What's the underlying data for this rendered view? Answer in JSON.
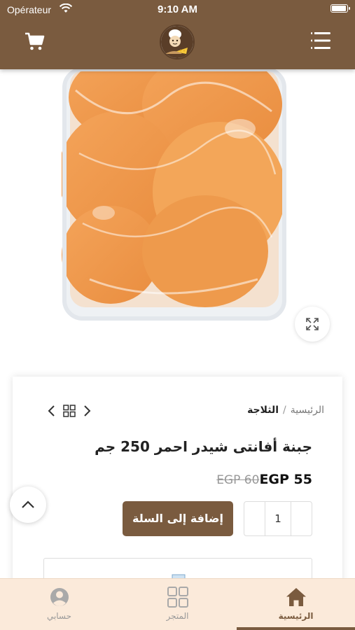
{
  "status_bar": {
    "carrier": "Opérateur",
    "time": "9:10 AM",
    "battery_level": 1.0
  },
  "header": {
    "cart_icon": "shopping-cart-icon",
    "logo": "store-logo",
    "menu_icon": "menu-lines-icon"
  },
  "product": {
    "image_alt": "product-photo",
    "breadcrumb": {
      "home": "الرئيسية",
      "separator": "/",
      "category": "الثلاجة"
    },
    "title": "جبنة أفانتى شيدر احمر 250 جم",
    "price_old": "EGP 60",
    "price_new": "EGP 55",
    "quantity": "1",
    "add_to_cart_label": "إضافة إلى السلة"
  },
  "bottom_nav": {
    "items": [
      {
        "label": "الرئيسية",
        "icon": "home-icon",
        "active": true
      },
      {
        "label": "المتجر",
        "icon": "grid-icon",
        "active": false
      },
      {
        "label": "حسابي",
        "icon": "user-icon",
        "active": false
      }
    ]
  },
  "colors": {
    "brand": "#7a5b3f",
    "nav_background": "#fbeada",
    "cheese": "#f2a55a"
  }
}
